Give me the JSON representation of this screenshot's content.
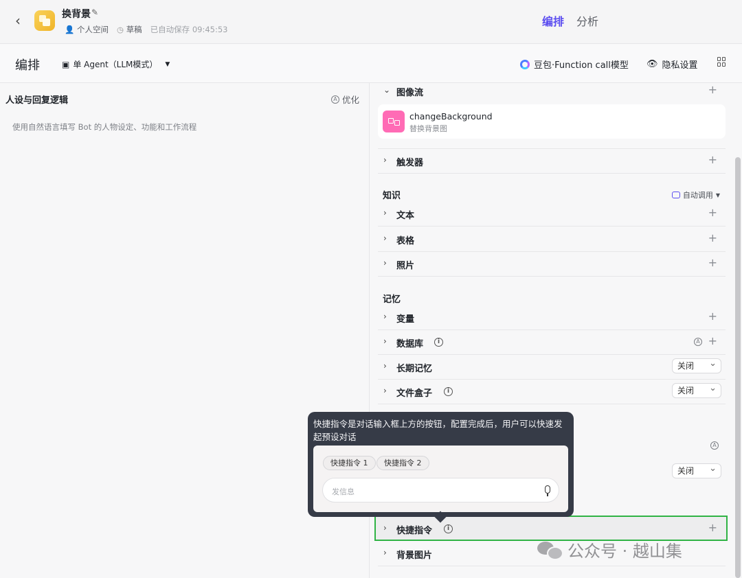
{
  "header": {
    "back_icon": "chevron-left-icon",
    "app_name": "换背景",
    "space": "个人空间",
    "status": "草稿",
    "autosave": "已自动保存 09:45:53",
    "tabs": [
      {
        "label": "编排",
        "active": true
      },
      {
        "label": "分析",
        "active": false
      }
    ],
    "accent_color": "#5b4df0"
  },
  "toolbar": {
    "title": "编排",
    "agent_mode": "单 Agent（LLM模式）",
    "model": "豆包·Function call模型",
    "privacy": "隐私设置"
  },
  "left_panel": {
    "title": "人设与回复逻辑",
    "optimize_label": "优化",
    "prompt_placeholder": "使用自然语言填写 Bot 的人物设定、功能和工作流程"
  },
  "right_panel": {
    "workflow": {
      "label": "图像流",
      "item_name": "changeBackground",
      "item_desc": "替换背景图"
    },
    "trigger_label": "触发器",
    "knowledge": {
      "title": "知识",
      "auto_call": "自动调用",
      "items": [
        "文本",
        "表格",
        "照片"
      ]
    },
    "memory": {
      "title": "记忆",
      "variable": "变量",
      "database": "数据库",
      "long_term_memory": "长期记忆",
      "long_term_memory_value": "关闭",
      "file_box": "文件盒子",
      "file_box_value": "关闭"
    },
    "hidden_row_value": "关闭",
    "shortcut_label": "快捷指令",
    "background_label": "背景图片"
  },
  "tooltip": {
    "text": "快捷指令是对话输入框上方的按钮，配置完成后，用户可以快速发起预设对话",
    "chips": [
      "快捷指令 1",
      "快捷指令 2"
    ],
    "input_placeholder": "发信息"
  },
  "watermark": "公众号 · 越山集"
}
